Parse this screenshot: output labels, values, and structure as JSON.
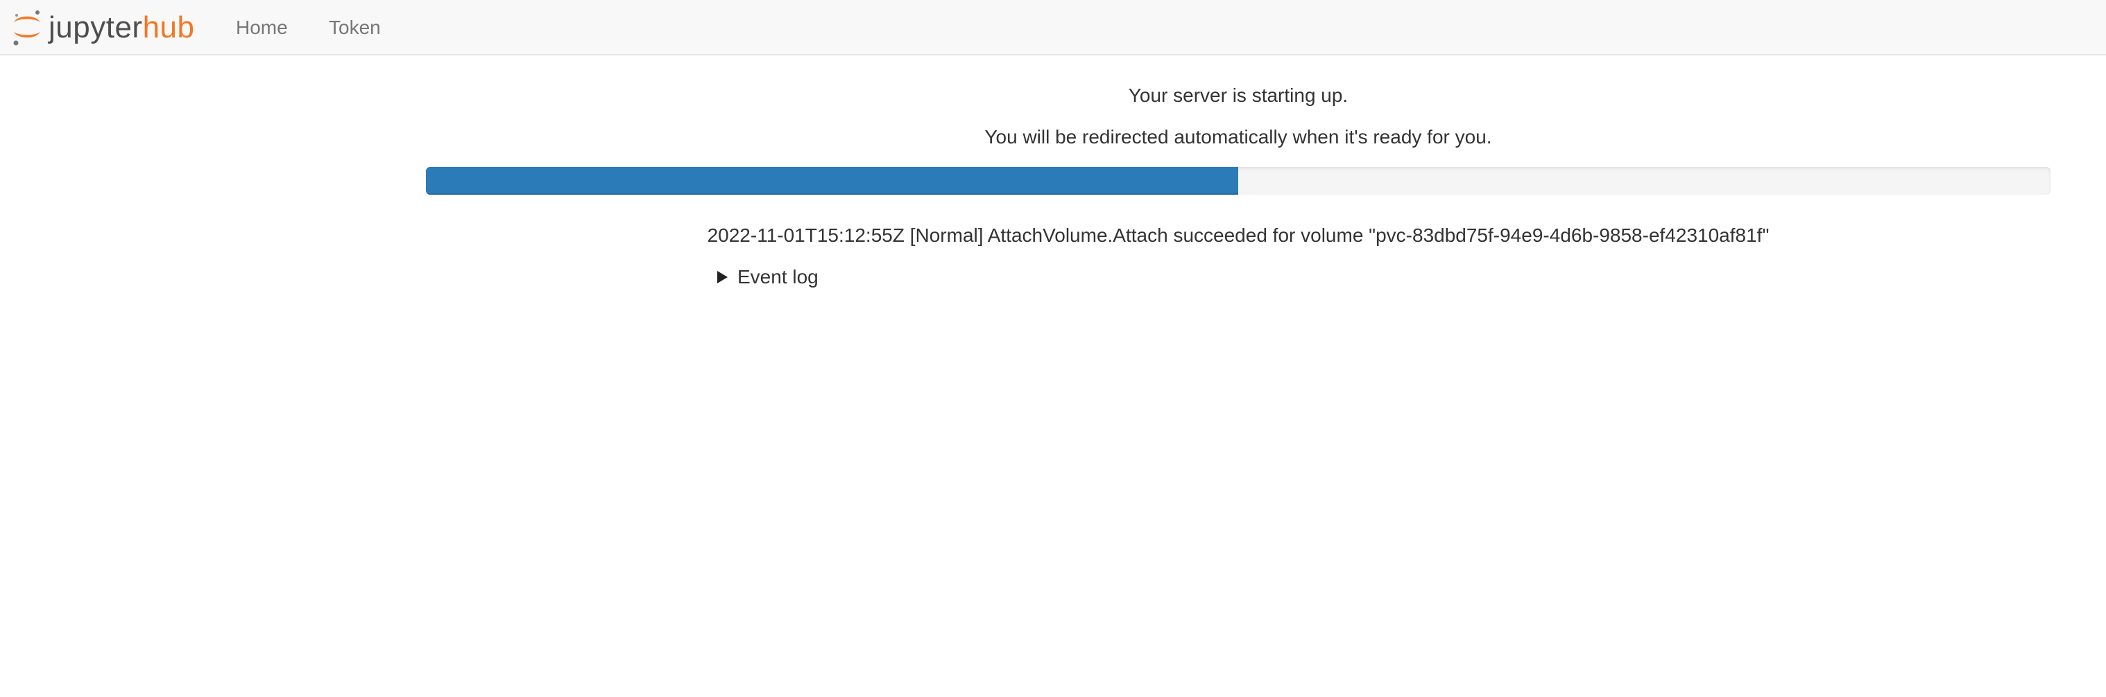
{
  "navbar": {
    "logo": {
      "icon": "jupyter-logo-icon",
      "text_primary": "jupyter",
      "text_accent": "hub",
      "accent_color": "#f37726"
    },
    "links": [
      {
        "label": "Home"
      },
      {
        "label": "Token"
      }
    ]
  },
  "main": {
    "status_message": "Your server is starting up.",
    "redirect_message": "You will be redirected automatically when it's ready for you.",
    "progress": {
      "percent": 50,
      "color": "#2a7bb8"
    },
    "latest_event": "2022-11-01T15:12:55Z [Normal] AttachVolume.Attach succeeded for volume \"pvc-83dbd75f-94e9-4d6b-9858-ef42310af81f\"",
    "event_log_label": "Event log",
    "event_log_icon": "disclosure-triangle-icon"
  }
}
